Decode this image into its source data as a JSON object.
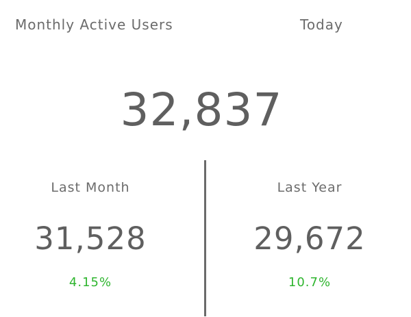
{
  "widget": {
    "title": "Monthly Active Users",
    "period": "Today",
    "current_value": "32,837",
    "comparisons": [
      {
        "label": "Last Month",
        "value": "31,528",
        "change": "4.15%"
      },
      {
        "label": "Last Year",
        "value": "29,672",
        "change": "10.7%"
      }
    ],
    "colors": {
      "text": "#616161",
      "positive_change": "#2fb52f",
      "divider": "#6a6a6a"
    }
  }
}
